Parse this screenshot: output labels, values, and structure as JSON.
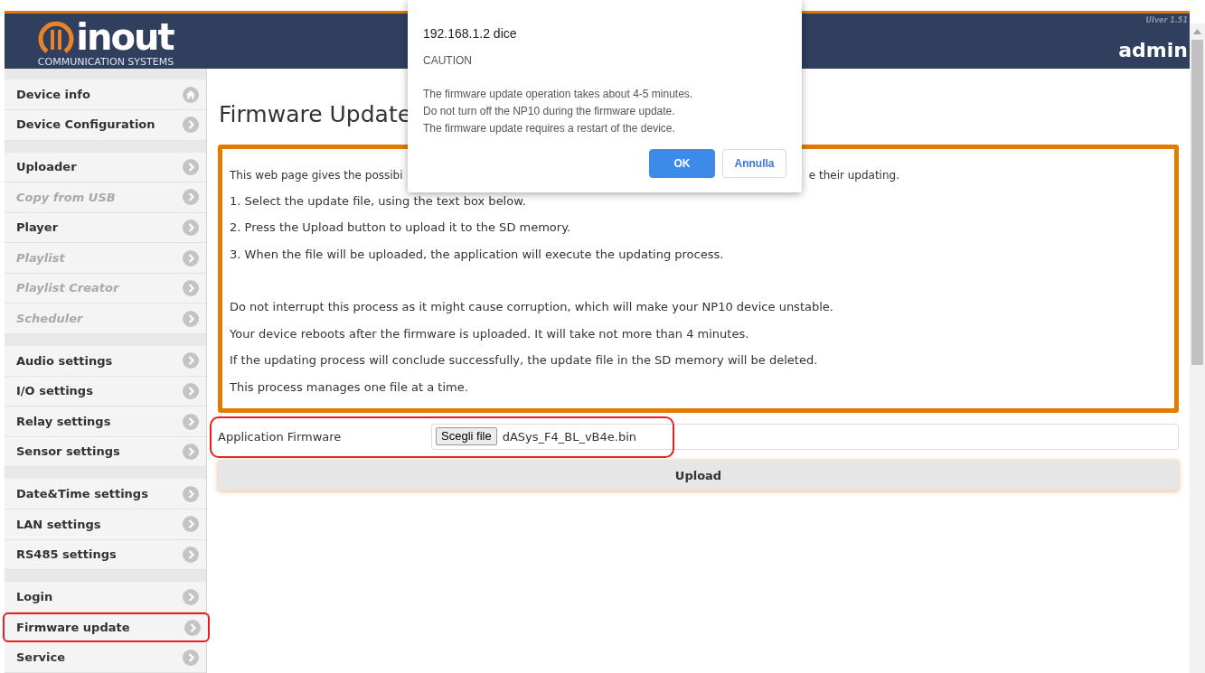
{
  "header": {
    "logo": {
      "wordmark": "inout",
      "tagline": "COMMUNICATION SYSTEMS"
    },
    "version": "UIver 1.51",
    "user": "admin"
  },
  "sidebar": {
    "groups": [
      [
        {
          "label": "Device info",
          "kind": "home",
          "disabled": false,
          "highlighted": false
        },
        {
          "label": "Device Configuration",
          "kind": "chevron",
          "disabled": false,
          "highlighted": false
        }
      ],
      [
        {
          "label": "Uploader",
          "kind": "chevron",
          "disabled": false,
          "highlighted": false
        },
        {
          "label": "Copy from USB",
          "kind": "chevron",
          "disabled": true,
          "highlighted": false
        },
        {
          "label": "Player",
          "kind": "chevron",
          "disabled": false,
          "highlighted": false
        },
        {
          "label": "Playlist",
          "kind": "chevron",
          "disabled": true,
          "highlighted": false
        },
        {
          "label": "Playlist Creator",
          "kind": "chevron",
          "disabled": true,
          "highlighted": false
        },
        {
          "label": "Scheduler",
          "kind": "chevron",
          "disabled": true,
          "highlighted": false
        }
      ],
      [
        {
          "label": "Audio settings",
          "kind": "chevron",
          "disabled": false,
          "highlighted": false
        },
        {
          "label": "I/O settings",
          "kind": "chevron",
          "disabled": false,
          "highlighted": false
        },
        {
          "label": "Relay settings",
          "kind": "chevron",
          "disabled": false,
          "highlighted": false
        },
        {
          "label": "Sensor settings",
          "kind": "chevron",
          "disabled": false,
          "highlighted": false
        }
      ],
      [
        {
          "label": "Date&Time settings",
          "kind": "chevron",
          "disabled": false,
          "highlighted": false
        },
        {
          "label": "LAN settings",
          "kind": "chevron",
          "disabled": false,
          "highlighted": false
        },
        {
          "label": "RS485 settings",
          "kind": "chevron",
          "disabled": false,
          "highlighted": false
        }
      ],
      [
        {
          "label": "Login",
          "kind": "chevron",
          "disabled": false,
          "highlighted": false
        },
        {
          "label": "Firmware update",
          "kind": "chevron",
          "disabled": false,
          "highlighted": true
        },
        {
          "label": "Service",
          "kind": "chevron",
          "disabled": false,
          "highlighted": false
        }
      ]
    ]
  },
  "page_title": "Firmware Update",
  "info_box": {
    "first_line": {
      "left": "This web page gives the possibi",
      "right": "e their updating."
    },
    "steps": [
      "1. Select the update file, using the text box below.",
      "2. Press the Upload button to upload it to the SD memory.",
      "3. When the file will be uploaded, the application will execute the updating process."
    ],
    "notes": [
      "Do not interrupt this process as it might cause corruption, which will make your NP10 device unstable.",
      "Your device reboots after the firmware is uploaded. It will take not more than 4 minutes.",
      "If the updating process will conclude successfully, the update file in the SD memory will be deleted.",
      "This process manages one file at a time."
    ]
  },
  "file_row": {
    "label": "Application Firmware",
    "button": "Scegli file",
    "file_name": "dASys_F4_BL_vB4e.bin",
    "highlighted": true
  },
  "upload_button": "Upload",
  "dialog": {
    "origin": "192.168.1.2 dice",
    "heading": "CAUTION",
    "lines": [
      "The firmware update operation takes about 4-5 minutes.",
      "Do not turn off the NP10 during the firmware update.",
      "The firmware update requires a restart of the device."
    ],
    "buttons": [
      {
        "label": "OK",
        "kind": "primary"
      },
      {
        "label": "Annulla",
        "kind": "secondary"
      }
    ]
  }
}
